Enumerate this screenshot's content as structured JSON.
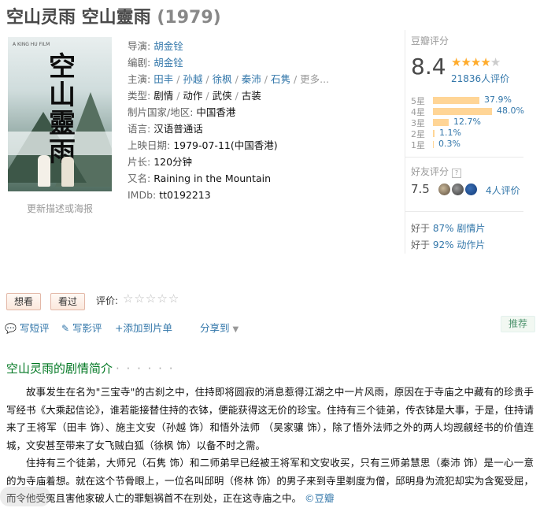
{
  "header": {
    "title": "空山灵雨 空山靈雨",
    "year": "(1979)"
  },
  "poster": {
    "update_link": "更新描述或海报",
    "calligraphy": "空山靈雨",
    "small_text": "A KING HU FILM"
  },
  "info": {
    "director_label": "导演:",
    "director": "胡金铨",
    "writer_label": "编剧:",
    "writer": "胡金铨",
    "cast_label": "主演:",
    "cast": [
      "田丰",
      "孙越",
      "徐枫",
      "秦沛",
      "石隽"
    ],
    "cast_more": "更多...",
    "genre_label": "类型:",
    "genres": [
      "剧情",
      "动作",
      "武侠",
      "古装"
    ],
    "region_label": "制片国家/地区:",
    "region": "中国香港",
    "language_label": "语言:",
    "language": "汉语普通话",
    "release_label": "上映日期:",
    "release": "1979-07-11(中国香港)",
    "runtime_label": "片长:",
    "runtime": "120分钟",
    "aka_label": "又名:",
    "aka": "Raining in the Mountain",
    "imdb_label": "IMDb:",
    "imdb": "tt0192213"
  },
  "rating": {
    "label": "豆瓣评分",
    "score": "8.4",
    "stars": 4,
    "people": "21836人评价",
    "distribution": [
      {
        "label": "5星",
        "pct": "37.9%",
        "value": 37.9
      },
      {
        "label": "4星",
        "pct": "48.0%",
        "value": 48.0
      },
      {
        "label": "3星",
        "pct": "12.7%",
        "value": 12.7
      },
      {
        "label": "2星",
        "pct": "1.1%",
        "value": 1.1
      },
      {
        "label": "1星",
        "pct": "0.3%",
        "value": 0.3
      }
    ],
    "friends_label": "好友评分",
    "friends_help": "?",
    "friends_score": "7.5",
    "friends_people": "4人评价",
    "better_than": [
      {
        "prefix": "好于",
        "pct": "87%",
        "genre": "剧情片"
      },
      {
        "prefix": "好于",
        "pct": "92%",
        "genre": "动作片"
      }
    ],
    "colors": {
      "star_on": "#ffac2d",
      "bar": "#ffd596",
      "link": "#3377aa"
    }
  },
  "actions": {
    "want": "想看",
    "seen": "看过",
    "rate_label": "评价:",
    "short_review": "写短评",
    "review": "写影评",
    "add_to_list": "+添加到片单",
    "share": "分享到",
    "recommend": "推荐"
  },
  "synopsis": {
    "title": "空山灵雨的剧情简介",
    "dots": "· · · · · ·",
    "p1": "故事发生在名为\"三宝寺\"的古刹之中，住持即将圆寂的消息惹得江湖之中一片风雨，原因在于寺庙之中藏有的珍贵手写经书《大乘起信论》，谁若能接替住持的衣钵，便能获得这无价的珍宝。住持有三个徒弟，传衣钵是大事，于是，住持请来了王将军（田丰 饰）、施主文安（孙越 饰）和悟外法师 （吴家骧 饰），除了悟外法师之外的两人均觊觎经书的价值连城，文安甚至带来了女飞贼白狐（徐枫 饰）以备不时之需。",
    "p2": "住持有三个徒弟，大师兄（石隽 饰）和二师弟早已经被王将军和文安收买，只有三师弟慧思（秦沛 饰）是一心一意的为寺庙着想。就在这个节骨眼上，一位名叫邱明（佟林 饰）的男子来到寺里剃度为僧，邱明身为流犯却实为含冤受屈，而令他受冤且害他家破人亡的罪魁祸首不在别处，正在这寺庙之中。",
    "source": "©豆瓣"
  }
}
